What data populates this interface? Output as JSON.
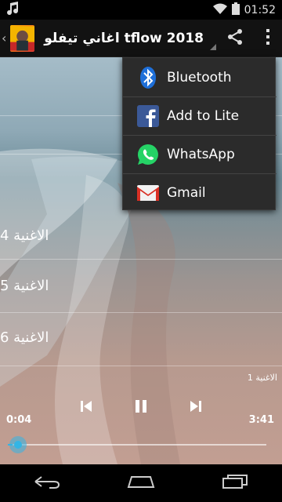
{
  "status_bar": {
    "time": "01:52"
  },
  "action_bar": {
    "title": "اغاني تيفلو tflow 2018"
  },
  "songs": [
    {
      "label": "الاغنية 4"
    },
    {
      "label": "الاغنية 5"
    },
    {
      "label": "الاغنية 6"
    }
  ],
  "player": {
    "now_playing": "الاغنية 1",
    "time_elapsed": "0:04",
    "time_total": "3:41",
    "progress_fraction": 0.018
  },
  "share_menu": {
    "items": [
      {
        "label": "Bluetooth",
        "icon": "bluetooth-icon"
      },
      {
        "label": "Add to Lite",
        "icon": "facebook-icon"
      },
      {
        "label": "WhatsApp",
        "icon": "whatsapp-icon"
      },
      {
        "label": "Gmail",
        "icon": "gmail-icon"
      }
    ]
  },
  "colors": {
    "accent": "#33b5e5",
    "popup_bg": "#2b2b2b",
    "facebook": "#3b5998",
    "whatsapp": "#25d366",
    "gmail": "#d93025"
  }
}
